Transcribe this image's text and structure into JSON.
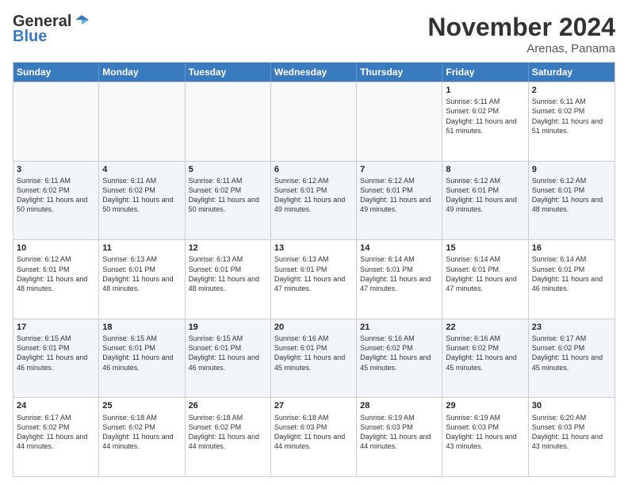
{
  "logo": {
    "general": "General",
    "blue": "Blue"
  },
  "title": "November 2024",
  "location": "Arenas, Panama",
  "header_days": [
    "Sunday",
    "Monday",
    "Tuesday",
    "Wednesday",
    "Thursday",
    "Friday",
    "Saturday"
  ],
  "weeks": [
    [
      {
        "day": "",
        "info": ""
      },
      {
        "day": "",
        "info": ""
      },
      {
        "day": "",
        "info": ""
      },
      {
        "day": "",
        "info": ""
      },
      {
        "day": "",
        "info": ""
      },
      {
        "day": "1",
        "info": "Sunrise: 6:11 AM\nSunset: 6:02 PM\nDaylight: 11 hours and 51 minutes."
      },
      {
        "day": "2",
        "info": "Sunrise: 6:11 AM\nSunset: 6:02 PM\nDaylight: 11 hours and 51 minutes."
      }
    ],
    [
      {
        "day": "3",
        "info": "Sunrise: 6:11 AM\nSunset: 6:02 PM\nDaylight: 11 hours and 50 minutes."
      },
      {
        "day": "4",
        "info": "Sunrise: 6:11 AM\nSunset: 6:02 PM\nDaylight: 11 hours and 50 minutes."
      },
      {
        "day": "5",
        "info": "Sunrise: 6:11 AM\nSunset: 6:02 PM\nDaylight: 11 hours and 50 minutes."
      },
      {
        "day": "6",
        "info": "Sunrise: 6:12 AM\nSunset: 6:01 PM\nDaylight: 11 hours and 49 minutes."
      },
      {
        "day": "7",
        "info": "Sunrise: 6:12 AM\nSunset: 6:01 PM\nDaylight: 11 hours and 49 minutes."
      },
      {
        "day": "8",
        "info": "Sunrise: 6:12 AM\nSunset: 6:01 PM\nDaylight: 11 hours and 49 minutes."
      },
      {
        "day": "9",
        "info": "Sunrise: 6:12 AM\nSunset: 6:01 PM\nDaylight: 11 hours and 48 minutes."
      }
    ],
    [
      {
        "day": "10",
        "info": "Sunrise: 6:12 AM\nSunset: 6:01 PM\nDaylight: 11 hours and 48 minutes."
      },
      {
        "day": "11",
        "info": "Sunrise: 6:13 AM\nSunset: 6:01 PM\nDaylight: 11 hours and 48 minutes."
      },
      {
        "day": "12",
        "info": "Sunrise: 6:13 AM\nSunset: 6:01 PM\nDaylight: 11 hours and 48 minutes."
      },
      {
        "day": "13",
        "info": "Sunrise: 6:13 AM\nSunset: 6:01 PM\nDaylight: 11 hours and 47 minutes."
      },
      {
        "day": "14",
        "info": "Sunrise: 6:14 AM\nSunset: 6:01 PM\nDaylight: 11 hours and 47 minutes."
      },
      {
        "day": "15",
        "info": "Sunrise: 6:14 AM\nSunset: 6:01 PM\nDaylight: 11 hours and 47 minutes."
      },
      {
        "day": "16",
        "info": "Sunrise: 6:14 AM\nSunset: 6:01 PM\nDaylight: 11 hours and 46 minutes."
      }
    ],
    [
      {
        "day": "17",
        "info": "Sunrise: 6:15 AM\nSunset: 6:01 PM\nDaylight: 11 hours and 46 minutes."
      },
      {
        "day": "18",
        "info": "Sunrise: 6:15 AM\nSunset: 6:01 PM\nDaylight: 11 hours and 46 minutes."
      },
      {
        "day": "19",
        "info": "Sunrise: 6:15 AM\nSunset: 6:01 PM\nDaylight: 11 hours and 46 minutes."
      },
      {
        "day": "20",
        "info": "Sunrise: 6:16 AM\nSunset: 6:01 PM\nDaylight: 11 hours and 45 minutes."
      },
      {
        "day": "21",
        "info": "Sunrise: 6:16 AM\nSunset: 6:02 PM\nDaylight: 11 hours and 45 minutes."
      },
      {
        "day": "22",
        "info": "Sunrise: 6:16 AM\nSunset: 6:02 PM\nDaylight: 11 hours and 45 minutes."
      },
      {
        "day": "23",
        "info": "Sunrise: 6:17 AM\nSunset: 6:02 PM\nDaylight: 11 hours and 45 minutes."
      }
    ],
    [
      {
        "day": "24",
        "info": "Sunrise: 6:17 AM\nSunset: 6:02 PM\nDaylight: 11 hours and 44 minutes."
      },
      {
        "day": "25",
        "info": "Sunrise: 6:18 AM\nSunset: 6:02 PM\nDaylight: 11 hours and 44 minutes."
      },
      {
        "day": "26",
        "info": "Sunrise: 6:18 AM\nSunset: 6:02 PM\nDaylight: 11 hours and 44 minutes."
      },
      {
        "day": "27",
        "info": "Sunrise: 6:18 AM\nSunset: 6:03 PM\nDaylight: 11 hours and 44 minutes."
      },
      {
        "day": "28",
        "info": "Sunrise: 6:19 AM\nSunset: 6:03 PM\nDaylight: 11 hours and 44 minutes."
      },
      {
        "day": "29",
        "info": "Sunrise: 6:19 AM\nSunset: 6:03 PM\nDaylight: 11 hours and 43 minutes."
      },
      {
        "day": "30",
        "info": "Sunrise: 6:20 AM\nSunset: 6:03 PM\nDaylight: 11 hours and 43 minutes."
      }
    ]
  ]
}
